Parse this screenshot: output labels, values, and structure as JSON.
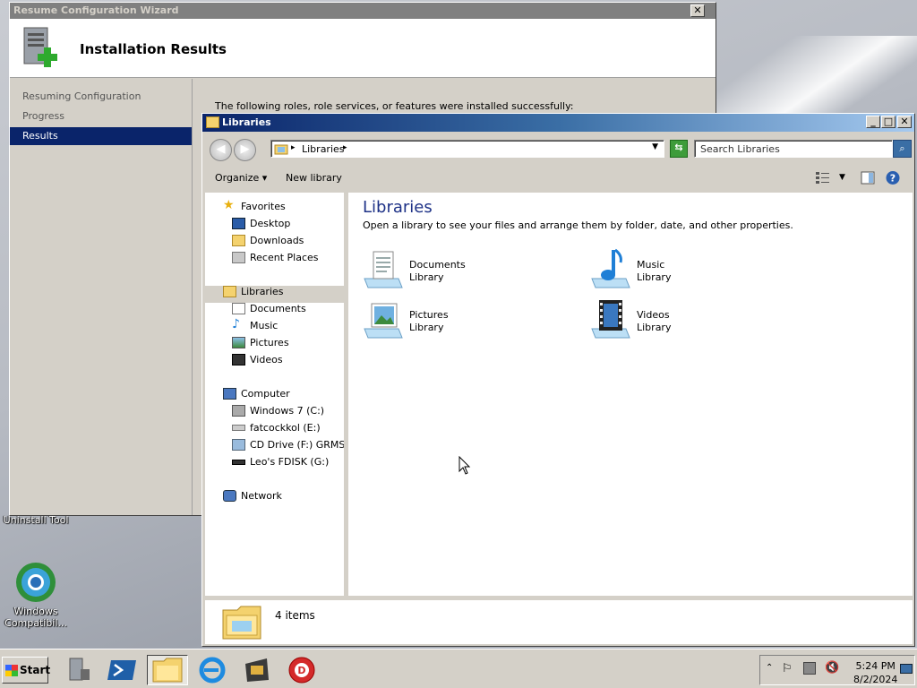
{
  "desktop": {
    "icons": [
      {
        "label": "Uninstall Tool"
      },
      {
        "label": "Windows Compatibil..."
      }
    ]
  },
  "wizard": {
    "title": "Resume Configuration Wizard",
    "close_label": "✕",
    "header_title": "Installation Results",
    "steps": [
      {
        "label": "Resuming Configuration",
        "selected": false
      },
      {
        "label": "Progress",
        "selected": false
      },
      {
        "label": "Results",
        "selected": true
      }
    ],
    "message": "The following roles, role services, or features were installed successfully:"
  },
  "explorer": {
    "title": "Libraries",
    "address": {
      "path": "Libraries"
    },
    "search_placeholder": "Search Libraries",
    "toolbar": {
      "organize_label": "Organize ▾",
      "new_library_label": "New library"
    },
    "nav": {
      "favorites": {
        "label": "Favorites",
        "items": [
          "Desktop",
          "Downloads",
          "Recent Places"
        ]
      },
      "libraries": {
        "label": "Libraries",
        "items": [
          "Documents",
          "Music",
          "Pictures",
          "Videos"
        ]
      },
      "computer": {
        "label": "Computer",
        "items": [
          "Windows 7 (C:)",
          "fatcockkol (E:)",
          "CD Drive (F:) GRMSXF",
          "Leo's FDISK (G:)"
        ]
      },
      "network": {
        "label": "Network"
      }
    },
    "content": {
      "title": "Libraries",
      "subtitle": "Open a library to see your files and arrange them by folder, date, and other properties.",
      "libraries": [
        {
          "name": "Documents",
          "kind": "Library",
          "icon": "documents-library-icon"
        },
        {
          "name": "Music",
          "kind": "Library",
          "icon": "music-library-icon"
        },
        {
          "name": "Pictures",
          "kind": "Library",
          "icon": "pictures-library-icon"
        },
        {
          "name": "Videos",
          "kind": "Library",
          "icon": "videos-library-icon"
        }
      ]
    },
    "status": {
      "item_count": "4 items"
    }
  },
  "taskbar": {
    "start_label": "Start",
    "tray": {
      "time": "5:24 PM",
      "date": "8/2/2024"
    }
  },
  "colors": {
    "selection": "#0a246a",
    "title_active": "#0a246a",
    "classic_face": "#d4d0c8"
  }
}
